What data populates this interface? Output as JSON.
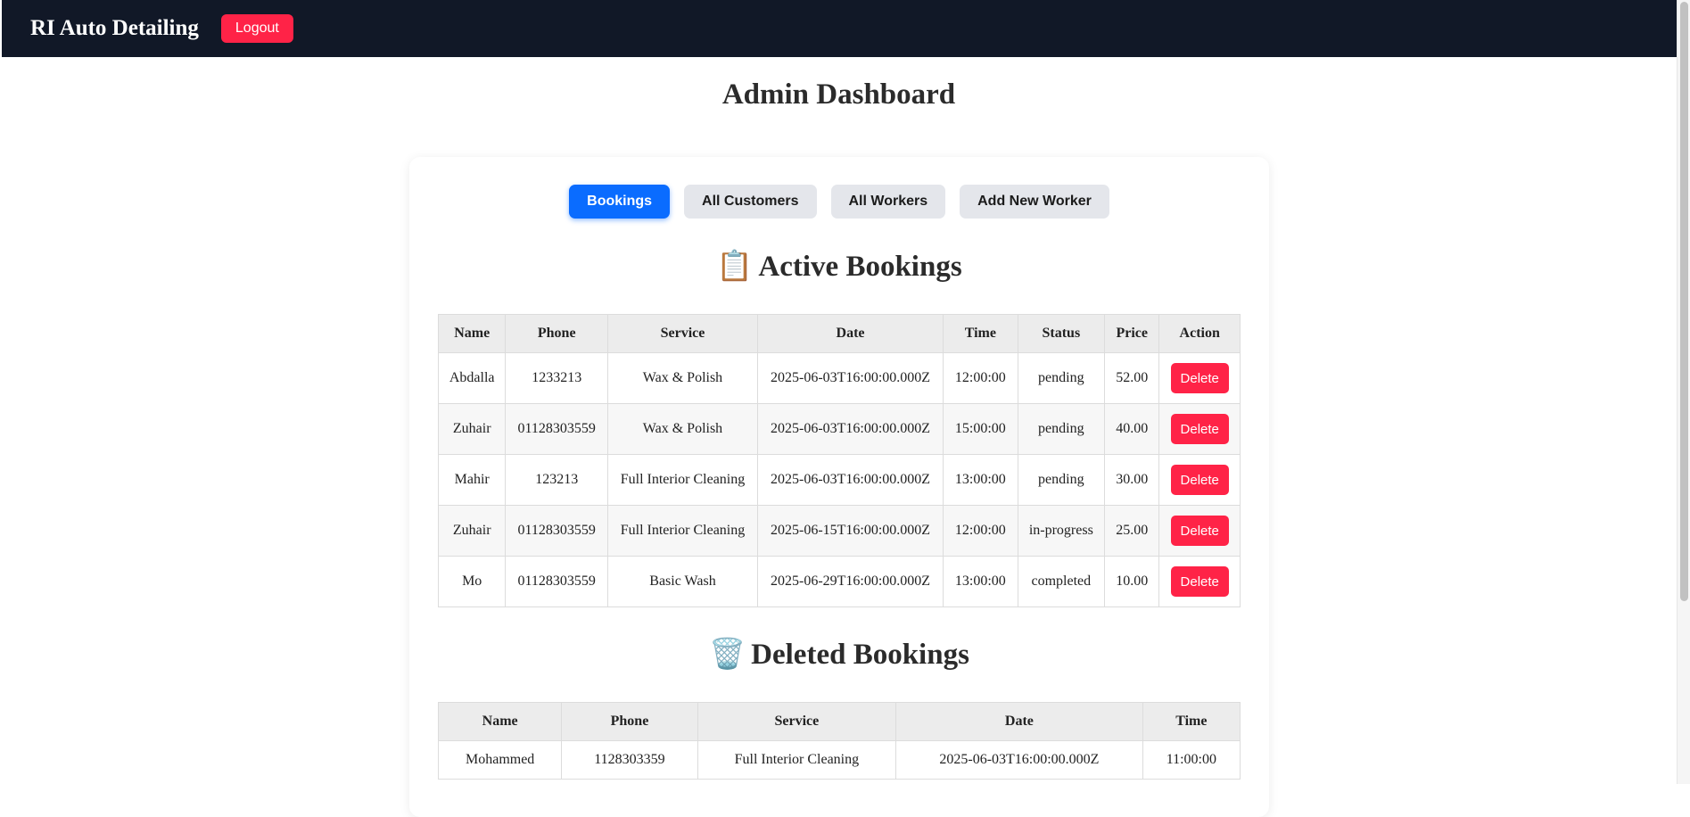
{
  "navbar": {
    "brand": "RI Auto Detailing",
    "logout_label": "Logout"
  },
  "page_title": "Admin Dashboard",
  "tabs": [
    {
      "label": "Bookings",
      "active": true
    },
    {
      "label": "All Customers",
      "active": false
    },
    {
      "label": "All Workers",
      "active": false
    },
    {
      "label": "Add New Worker",
      "active": false
    }
  ],
  "active_bookings": {
    "icon": "clipboard-icon",
    "emoji": "📋",
    "title": "Active Bookings",
    "columns": [
      "Name",
      "Phone",
      "Service",
      "Date",
      "Time",
      "Status",
      "Price",
      "Action"
    ],
    "delete_label": "Delete",
    "rows": [
      {
        "name": "Abdalla",
        "phone": "1233213",
        "service": "Wax & Polish",
        "date": "2025-06-03T16:00:00.000Z",
        "time": "12:00:00",
        "status": "pending",
        "price": "52.00"
      },
      {
        "name": "Zuhair",
        "phone": "01128303559",
        "service": "Wax & Polish",
        "date": "2025-06-03T16:00:00.000Z",
        "time": "15:00:00",
        "status": "pending",
        "price": "40.00"
      },
      {
        "name": "Mahir",
        "phone": "123213",
        "service": "Full Interior Cleaning",
        "date": "2025-06-03T16:00:00.000Z",
        "time": "13:00:00",
        "status": "pending",
        "price": "30.00"
      },
      {
        "name": "Zuhair",
        "phone": "01128303559",
        "service": "Full Interior Cleaning",
        "date": "2025-06-15T16:00:00.000Z",
        "time": "12:00:00",
        "status": "in-progress",
        "price": "25.00"
      },
      {
        "name": "Mo",
        "phone": "01128303559",
        "service": "Basic Wash",
        "date": "2025-06-29T16:00:00.000Z",
        "time": "13:00:00",
        "status": "completed",
        "price": "10.00"
      }
    ]
  },
  "deleted_bookings": {
    "icon": "trash-icon",
    "emoji": "🗑️",
    "title": "Deleted Bookings",
    "columns": [
      "Name",
      "Phone",
      "Service",
      "Date",
      "Time"
    ],
    "rows": [
      {
        "name": "Mohammed",
        "phone": "1128303359",
        "service": "Full Interior Cleaning",
        "date": "2025-06-03T16:00:00.000Z",
        "time": "11:00:00"
      }
    ]
  }
}
